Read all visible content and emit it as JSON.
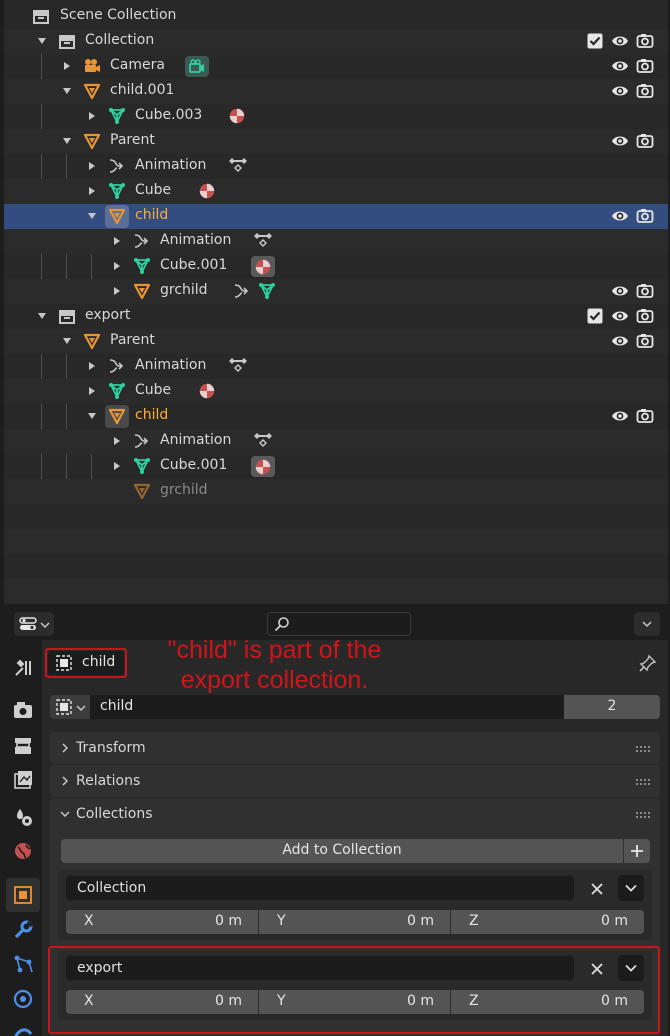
{
  "outliner": {
    "scene_collection": "Scene Collection",
    "rows": [
      {
        "label": "Collection",
        "type": "collection"
      },
      {
        "label": "Camera",
        "type": "camera"
      },
      {
        "label": "child.001",
        "type": "empty"
      },
      {
        "label": "Cube.003",
        "type": "mesh"
      },
      {
        "label": "Parent",
        "type": "empty"
      },
      {
        "label": "Animation",
        "type": "animation"
      },
      {
        "label": "Cube",
        "type": "mesh"
      },
      {
        "label": "child",
        "type": "empty",
        "selected": true
      },
      {
        "label": "Animation",
        "type": "animation"
      },
      {
        "label": "Cube.001",
        "type": "mesh"
      },
      {
        "label": "grchild",
        "type": "empty"
      },
      {
        "label": "export",
        "type": "collection"
      },
      {
        "label": "Parent",
        "type": "empty"
      },
      {
        "label": "Animation",
        "type": "animation"
      },
      {
        "label": "Cube",
        "type": "mesh"
      },
      {
        "label": "child",
        "type": "empty"
      },
      {
        "label": "Animation",
        "type": "animation"
      },
      {
        "label": "Cube.001",
        "type": "mesh"
      },
      {
        "label": "grchild",
        "type": "empty",
        "dimmed": true
      }
    ]
  },
  "properties": {
    "object_name": "child",
    "datablock_name": "child",
    "user_count": "2",
    "panels": {
      "transform": "Transform",
      "relations": "Relations",
      "collections": "Collections"
    },
    "add_to_collection": "Add to Collection",
    "collection_entries": [
      {
        "name": "Collection",
        "x_label": "X",
        "x_value": "0 m",
        "y_label": "Y",
        "y_value": "0 m",
        "z_label": "Z",
        "z_value": "0 m"
      },
      {
        "name": "export",
        "x_label": "X",
        "x_value": "0 m",
        "y_label": "Y",
        "y_value": "0 m",
        "z_label": "Z",
        "z_value": "0 m"
      }
    ]
  },
  "annotation": {
    "line1": "\"child\" is part of the",
    "line2": "export collection."
  },
  "colors": {
    "accent_selected": "#334d80",
    "active_text": "#ffaf29",
    "annotation_red": "#d0141a",
    "mesh_green": "#2ecfa0",
    "object_orange": "#e8953a"
  }
}
